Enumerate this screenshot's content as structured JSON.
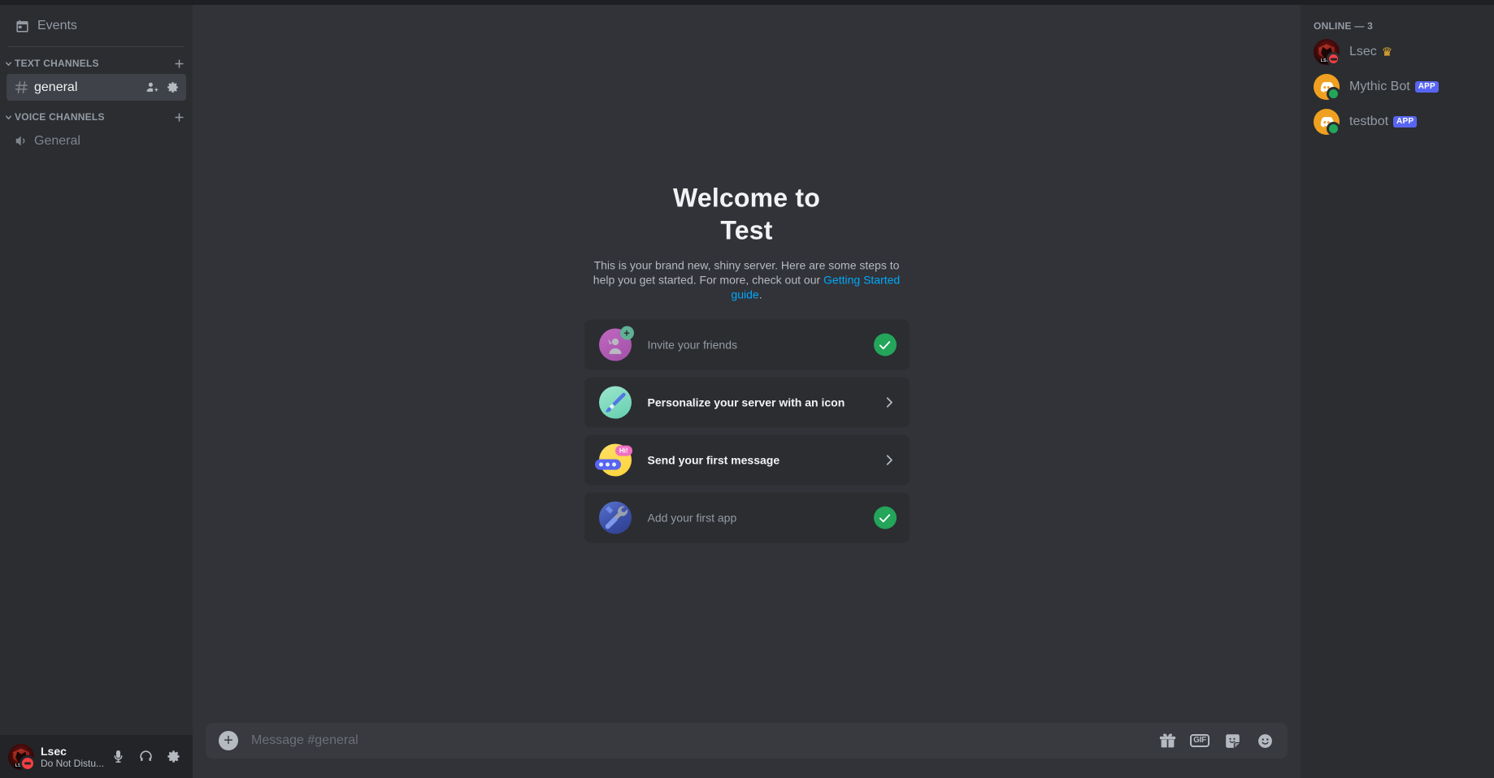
{
  "sidebar": {
    "events_label": "Events",
    "events_icon": "calendar-icon",
    "text_category": "TEXT CHANNELS",
    "voice_category": "VOICE CHANNELS",
    "add_channel_label": "+",
    "text_channels": [
      {
        "name": "general",
        "active": true,
        "icon": "hash-icon",
        "actions": [
          "create-invite-icon",
          "edit-channel-icon"
        ]
      }
    ],
    "voice_channels": [
      {
        "name": "General",
        "active": false,
        "icon": "speaker-icon"
      }
    ]
  },
  "user_panel": {
    "username": "Lsec",
    "status": "Do Not Distu...",
    "status_type": "dnd",
    "avatar": "lsec-logo-avatar",
    "buttons": [
      {
        "name": "mute-button",
        "icon": "microphone-icon"
      },
      {
        "name": "deafen-button",
        "icon": "headphones-icon"
      },
      {
        "name": "user-settings-button",
        "icon": "gear-icon"
      }
    ]
  },
  "welcome": {
    "title_line1": "Welcome to",
    "title_line2": "Test",
    "desc_before": "This is your brand new, shiny server. Here are some steps to help you get started. For more, check out our ",
    "link_text": "Getting Started guide",
    "desc_after": "."
  },
  "onboarding_cards": [
    {
      "label": "Invite your friends",
      "icon": "invite-friends-icon",
      "state": "done",
      "action_icon": "check-circle-icon"
    },
    {
      "label": "Personalize your server with an icon",
      "icon": "paintbrush-icon",
      "state": "todo",
      "action_icon": "chevron-right-icon"
    },
    {
      "label": "Send your first message",
      "icon": "chat-bubble-icon",
      "state": "todo",
      "action_icon": "chevron-right-icon"
    },
    {
      "label": "Add your first app",
      "icon": "wrench-app-icon",
      "state": "done",
      "action_icon": "check-circle-icon"
    }
  ],
  "composer": {
    "placeholder": "Message #general",
    "value": "",
    "add_button_icon": "plus-circle-icon",
    "buttons": [
      {
        "name": "gift-button",
        "icon": "gift-icon",
        "label": ""
      },
      {
        "name": "gif-button",
        "icon": "gif-icon",
        "label": "GIF"
      },
      {
        "name": "sticker-button",
        "icon": "sticker-icon",
        "label": ""
      },
      {
        "name": "emoji-button",
        "icon": "emoji-icon",
        "label": ""
      }
    ]
  },
  "members": {
    "header": "ONLINE — 3",
    "list": [
      {
        "name": "Lsec",
        "avatar": "lsec-logo-avatar",
        "status": "dnd",
        "crown": "♛",
        "badge": ""
      },
      {
        "name": "Mythic Bot",
        "avatar": "discord-bot-avatar",
        "status": "online",
        "crown": "",
        "badge": "APP"
      },
      {
        "name": "testbot",
        "avatar": "discord-bot-avatar",
        "status": "online",
        "crown": "",
        "badge": "APP"
      }
    ]
  },
  "colors": {
    "sidebar_bg": "#2b2d31",
    "main_bg": "#313338",
    "composer_bg": "#383a40",
    "card_bg": "#2b2d31",
    "accent_blurple": "#5865f2",
    "link_blue": "#00a8fc",
    "success_green": "#23a55a",
    "dnd_red": "#f23f43",
    "online_green": "#23a55a"
  }
}
